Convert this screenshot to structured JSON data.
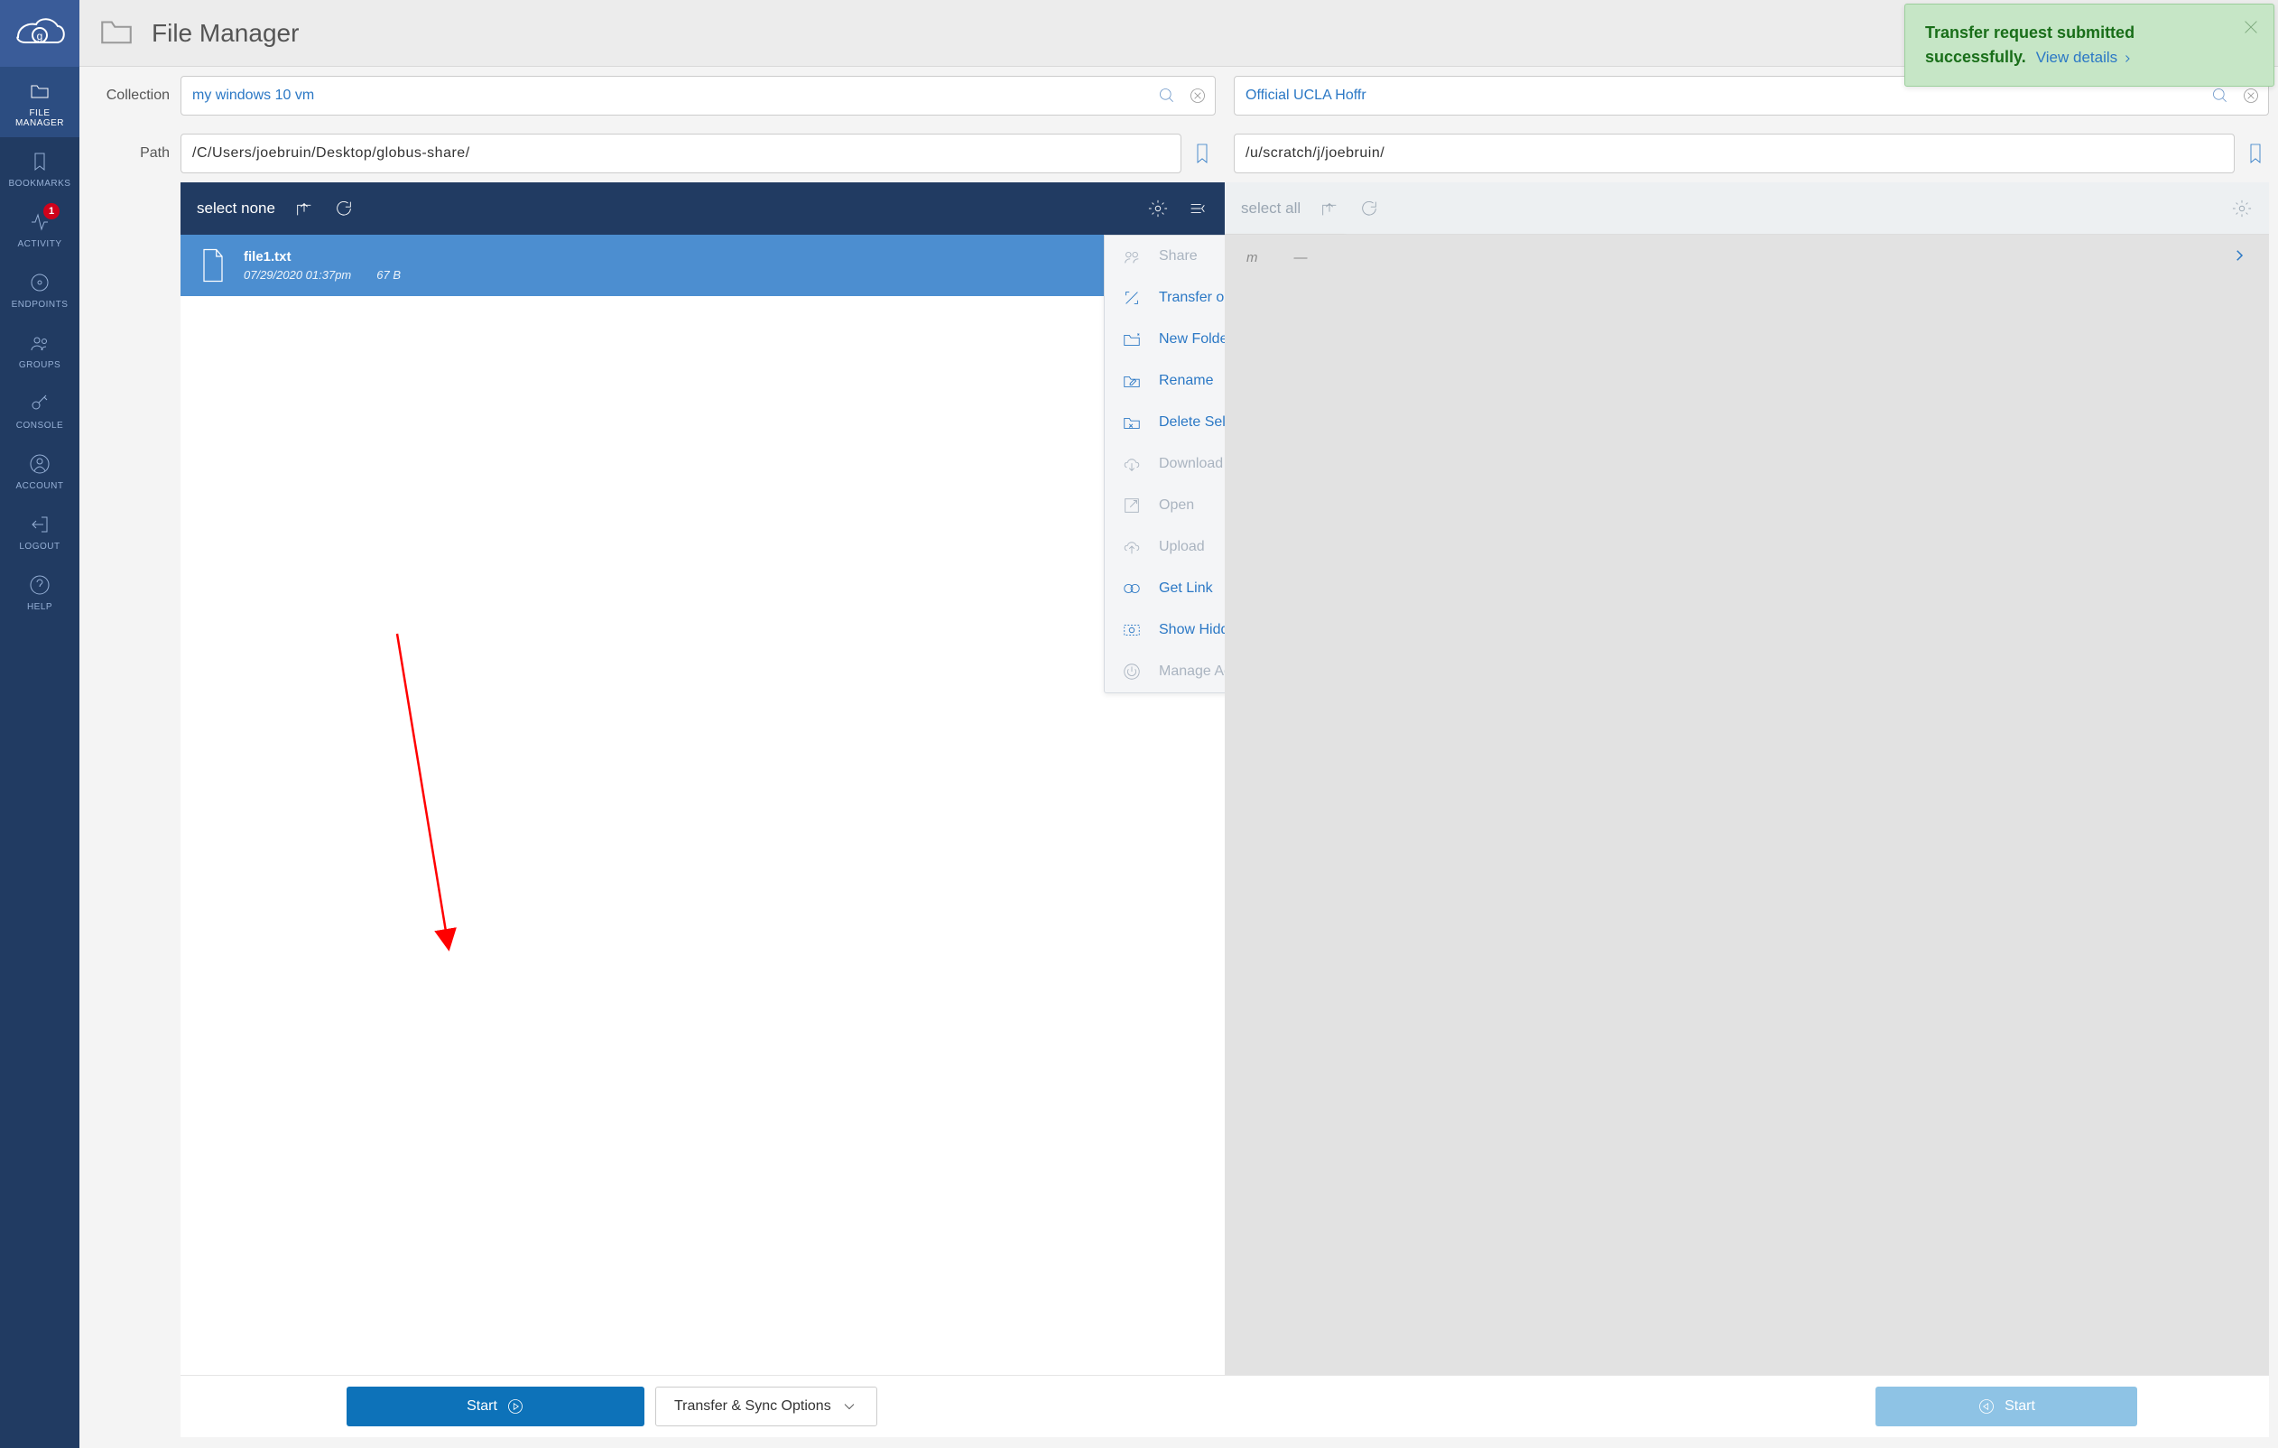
{
  "app": {
    "title": "File Manager"
  },
  "sidebar": {
    "items": [
      {
        "label": "FILE MANAGER"
      },
      {
        "label": "BOOKMARKS"
      },
      {
        "label": "ACTIVITY",
        "badge": "1"
      },
      {
        "label": "ENDPOINTS"
      },
      {
        "label": "GROUPS"
      },
      {
        "label": "CONSOLE"
      },
      {
        "label": "ACCOUNT"
      },
      {
        "label": "LOGOUT"
      },
      {
        "label": "HELP"
      }
    ]
  },
  "labels": {
    "collection": "Collection",
    "path": "Path"
  },
  "left": {
    "collection": "my windows 10 vm",
    "path": "/C/Users/joebruin/Desktop/globus-share/",
    "select_label": "select none",
    "files": [
      {
        "name": "file1.txt",
        "date": "07/29/2020 01:37pm",
        "size": "67 B"
      }
    ]
  },
  "right": {
    "collection": "Official UCLA Hoffr",
    "path": "/u/scratch/j/joebruin/",
    "select_label": "select all",
    "hint_date_fragment": "m",
    "hint_dash": "—"
  },
  "context_menu": [
    {
      "label": "Share",
      "enabled": false,
      "icon": "share"
    },
    {
      "label": "Transfer or Sync to...",
      "enabled": true,
      "icon": "transfer"
    },
    {
      "label": "New Folder",
      "enabled": true,
      "icon": "newfolder"
    },
    {
      "label": "Rename",
      "enabled": true,
      "icon": "rename"
    },
    {
      "label": "Delete Selected",
      "enabled": true,
      "icon": "delete"
    },
    {
      "label": "Download",
      "enabled": false,
      "icon": "download"
    },
    {
      "label": "Open",
      "enabled": false,
      "icon": "open"
    },
    {
      "label": "Upload",
      "enabled": false,
      "icon": "upload"
    },
    {
      "label": "Get Link",
      "enabled": true,
      "icon": "link"
    },
    {
      "label": "Show Hidden Items",
      "enabled": true,
      "icon": "eye"
    },
    {
      "label": "Manage Activation",
      "enabled": false,
      "icon": "power"
    }
  ],
  "footer": {
    "start_left": "Start",
    "start_right": "Start",
    "options": "Transfer & Sync Options"
  },
  "toast": {
    "title": "Transfer request submitted successfully.",
    "link": "View details"
  }
}
